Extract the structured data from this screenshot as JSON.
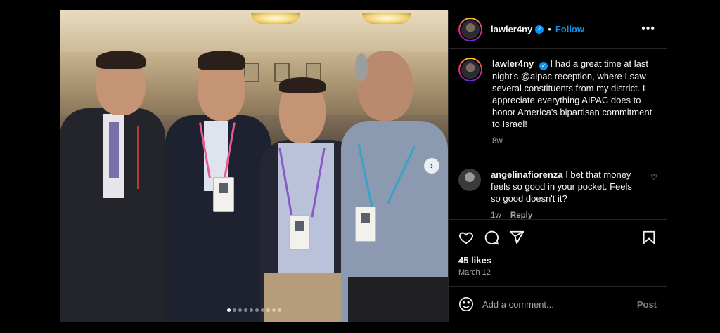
{
  "header": {
    "username": "lawler4ny",
    "separator": "•",
    "follow_label": "Follow",
    "more_icon": "more-horizontal-icon",
    "more_glyph": "•••"
  },
  "caption": {
    "username": "lawler4ny",
    "text": "I had a great time at last night's @aipac reception, where I saw several constituents from my district. I appreciate everything AIPAC does to honor America's bipartisan commitment to Israel!",
    "age": "8w"
  },
  "comments": [
    {
      "username": "angelinafiorenza",
      "text": "I bet that money feels so good in your pocket. Feels so good doesn't it?",
      "age": "1w",
      "reply_label": "Reply"
    }
  ],
  "actions": {
    "icons": [
      "heart-icon",
      "comment-icon",
      "share-icon",
      "bookmark-icon"
    ],
    "likes": "45 likes",
    "date": "March 12"
  },
  "add_comment": {
    "placeholder": "Add a comment...",
    "post_label": "Post",
    "emoji_icon": "emoji-icon"
  },
  "media": {
    "next_glyph": "›",
    "carousel_dots": 10,
    "active_dot": 1
  },
  "colors": {
    "background": "#000000",
    "accent": "#0095f6",
    "muted": "#a8a8a8",
    "border": "#262626"
  }
}
